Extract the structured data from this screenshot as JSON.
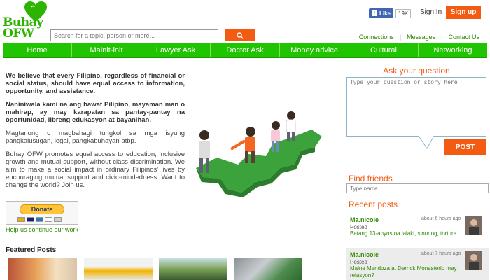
{
  "brand": {
    "logo_text": "Buhay OFW"
  },
  "search": {
    "placeholder": "Search for a topic, person or more..."
  },
  "header": {
    "fb_like_label": "Like",
    "fb_like_count": "19K",
    "sign_in": "Sign In",
    "sign_up": "Sign up",
    "links": [
      "Connections",
      "Messages",
      "Contact Us"
    ]
  },
  "nav": {
    "items": [
      "Home",
      "Mainit-init",
      "Lawyer Ask",
      "Doctor Ask",
      "Money advice",
      "Cultural",
      "Networking"
    ]
  },
  "intro": {
    "p1": "We believe that every Filipino, regardless of financial or social status, should have equal access to information, opportunity, and assistance.",
    "p2": "Naniniwala kami na ang bawat Pilipino, mayaman man o mahirap, ay may karapatan sa pantay-pantay na oportunidad, libreng edukasyon at bayanihan.",
    "p3": "Magtanong o magbahagi   tungkol sa mga isyung pangkalusugan, legal, pangkabuhayan atbp.",
    "p4": "Buhay OFW promotes equal access to education, inclusive growth and mutual support, without class discrimination. We aim to make a social impact in ordinary Filipinos' lives by encouraging mutual support and civic-mindedness. Want to change the world? Join us."
  },
  "donate": {
    "button_label": "Donate",
    "caption": "Help us continue our work"
  },
  "featured": {
    "title": "Featured Posts"
  },
  "ask": {
    "title": "Ask your question",
    "placeholder": "Type your question or story here",
    "post_label": "POST"
  },
  "find_friends": {
    "title": "Find friends",
    "placeholder": "Type name..."
  },
  "recent": {
    "title": "Recent posts",
    "posts": [
      {
        "author": "Ma.nicole",
        "time": "about 6 hours ago",
        "posted": "Posted",
        "text": "Batang 13-anyos na lalaki, sinunog, torture"
      },
      {
        "author": "Ma.nicole",
        "time": "about 7 hours ago",
        "posted": "Posted",
        "text": "Maine Mendoza at Derrick Monasterio may relasyon?"
      }
    ]
  },
  "colors": {
    "green": "#21c400",
    "orange": "#f35b13",
    "link_green": "#2d8a00"
  }
}
